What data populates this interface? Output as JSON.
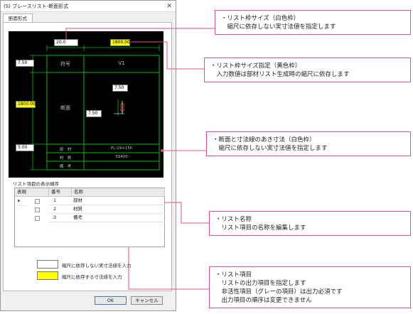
{
  "dialog": {
    "title": "(S) ブレースリスト-断面形式",
    "close_glyph": "✕",
    "tab_label": "断面形式",
    "ok_label": "OK",
    "cancel_label": "キャンセル"
  },
  "preview": {
    "top_dim": "20.0",
    "top_dim_yellow": "1800.00",
    "left_dim_top": "7.50",
    "left_dim_yellow": "1800.00",
    "left_dim_bottom": "5.00",
    "inner_dim_1": "7.50",
    "inner_dim_2": "7.50",
    "symbol_header": "符号",
    "symbol_value": "V1",
    "section_header": "断面",
    "row_member_label": "部　材",
    "row_member_value": "PL-19×150",
    "row_material_label": "材　質",
    "row_material_value": "SS400",
    "row_remarks_label": "備　考"
  },
  "list_order": {
    "label": "リスト項目の表示順序",
    "headers": [
      "表現",
      "番号",
      "名称"
    ],
    "row_pointer": "▶",
    "rows": [
      {
        "num": "1",
        "name": "部材"
      },
      {
        "num": "2",
        "name": "材質"
      },
      {
        "num": "3",
        "name": "備考"
      }
    ]
  },
  "legend": {
    "white_text": "縮尺に依存しない実寸法値を入力",
    "yellow_text": "縮尺に依存する寸法値を入力"
  },
  "callouts": [
    {
      "lines": [
        "・リスト枠サイズ（白色枠）",
        "　縮尺に依存しない実寸法値を指定します"
      ]
    },
    {
      "lines": [
        "・リスト枠サイズ指定（黄色枠）",
        "　入力数値は部材リスト生成時の縮尺に依存します"
      ]
    },
    {
      "lines": [
        "・断面と寸法線のあき寸法（白色枠）",
        "　縮尺に依存しない実寸法値を指定します"
      ]
    },
    {
      "lines": [
        "・リスト名称",
        "　リスト項目の名称を編集します"
      ]
    },
    {
      "lines": [
        "・リスト項目",
        "　リストの出力項目を指定します",
        "　非活性項目（グレーの項目）は出力必須です",
        "　出力項目の順序は変更できません"
      ]
    }
  ],
  "colors": {
    "accent": "#e44e8e",
    "preview_line": "#00c000",
    "highlight": "#ffff00"
  }
}
